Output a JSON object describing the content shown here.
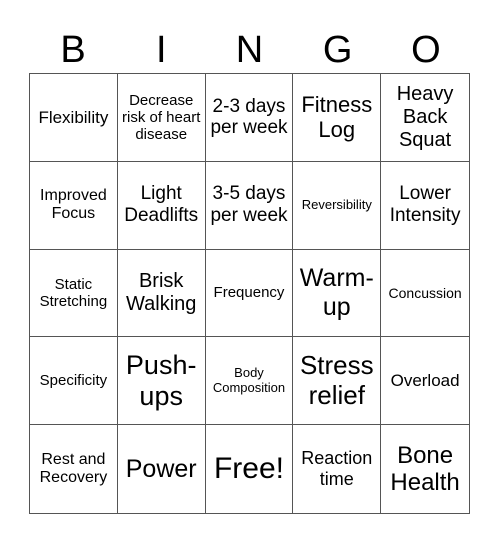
{
  "header": [
    "B",
    "I",
    "N",
    "G",
    "O"
  ],
  "cells": [
    "Flexibility",
    "Decrease risk of heart disease",
    "2-3 days per week",
    "Fitness Log",
    "Heavy Back Squat",
    "Improved Focus",
    "Light Deadlifts",
    "3-5 days per week",
    "Reversibility",
    "Lower Intensity",
    "Static Stretching",
    "Brisk Walking",
    "Frequency",
    "Warm-up",
    "Concussion",
    "Specificity",
    "Push-ups",
    "Body Composition",
    "Stress relief",
    "Overload",
    "Rest and Recovery",
    "Power",
    "Free!",
    "Reaction time",
    "Bone Health"
  ]
}
